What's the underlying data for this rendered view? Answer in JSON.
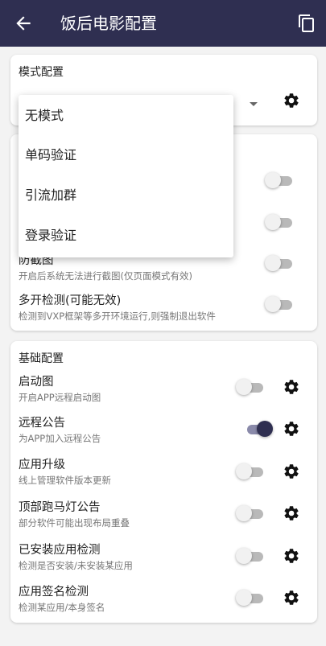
{
  "appbar": {
    "title": "饭后电影配置",
    "back_icon": "arrow-back-icon",
    "copy_icon": "copy-icon"
  },
  "mode_card": {
    "title": "模式配置"
  },
  "dropdown": {
    "options": [
      "无模式",
      "单码验证",
      "引流加群",
      "登录验证"
    ]
  },
  "security_card": {
    "rows": [
      {
        "label": "防截图",
        "sub": "开启后系统无法进行截图(仅页面模式有效)",
        "on": false
      },
      {
        "label": "多开检测(可能无效)",
        "sub": "检测到VXP框架等多开环境运行,则强制退出软件",
        "on": false
      }
    ]
  },
  "basic_card": {
    "title": "基础配置",
    "rows": [
      {
        "label": "启动图",
        "sub": "开启APP远程启动图",
        "on": false
      },
      {
        "label": "远程公告",
        "sub": "为APP加入远程公告",
        "on": true
      },
      {
        "label": "应用升级",
        "sub": "线上管理软件版本更新",
        "on": false
      },
      {
        "label": "顶部跑马灯公告",
        "sub": "部分软件可能出现布局重叠",
        "on": false
      },
      {
        "label": "已安装应用检测",
        "sub": "检测是否安装/未安装某应用",
        "on": false
      },
      {
        "label": "应用签名检测",
        "sub": "检测某应用/本身签名",
        "on": false
      }
    ]
  },
  "colors": {
    "appbar": "#2f2f51",
    "toggle_on": "#2f2f51"
  }
}
